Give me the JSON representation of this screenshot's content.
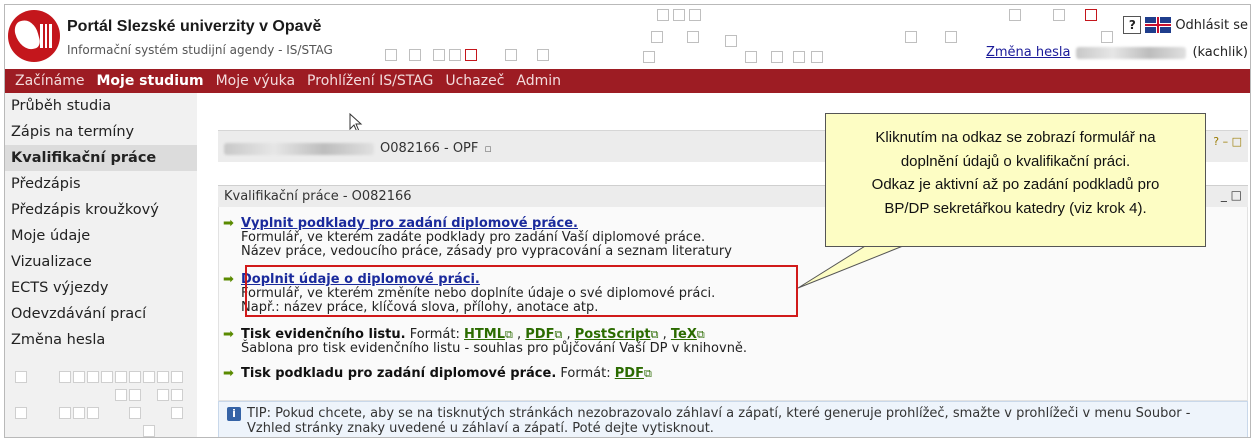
{
  "header": {
    "title": "Portál Slezské univerzity v Opavě",
    "subtitle": "Informační systém studijní agendy - IS/STAG",
    "help": "?",
    "logout": "Odhlásit se",
    "change_password": "Změna hesla",
    "username": "(kachlik)"
  },
  "menu": {
    "items": [
      "Začínáme",
      "Moje studium",
      "Moje výuka",
      "Prohlížení IS/STAG",
      "Uchazeč",
      "Admin"
    ],
    "active": "Moje studium"
  },
  "sidebar": {
    "items": [
      "Průběh studia",
      "Zápis na termíny",
      "Kvalifikační práce",
      "Předzápis",
      "Předzápis kroužkový",
      "Moje údaje",
      "Vizualizace",
      "ECTS výjezdy",
      "Odevzdávání prací",
      "Změna hesla"
    ],
    "active": "Kvalifikační práce"
  },
  "student_bar": {
    "id": "O082166 - OPF",
    "controls": "? – □"
  },
  "panel": {
    "title": "Kvalifikační práce - O082166",
    "controls": "_ □",
    "items": [
      {
        "link": "Vyplnit podklady pro zadání diplomové práce.",
        "desc1": "Formulář, ve kterém zadáte podklady pro zadání Vaší diplomové práce.",
        "desc2": "Název práce, vedoucího práce, zásady pro vypracování a seznam literatury"
      },
      {
        "link": "Doplnit údaje o diplomové práci.",
        "desc1": "Formulář, ve kterém změníte nebo doplníte údaje o své diplomové práci.",
        "desc2": "Např.: název práce, klíčová slova, přílohy, anotace atp."
      },
      {
        "label": "Tisk evidenčního listu.",
        "format_label": "Formát:",
        "formats": [
          "HTML",
          "PDF",
          "PostScript",
          "TeX"
        ],
        "desc1": "Šablona pro tisk evidenčního listu - souhlas pro půjčování Vaší DP v knihovně."
      },
      {
        "label": "Tisk podkladu pro zadání diplomové práce.",
        "format_label": "Formát:",
        "formats": [
          "PDF"
        ]
      }
    ]
  },
  "tip": {
    "text": "TIP: Pokud chcete, aby se na tisknutých stránkách nezobrazovalo záhlaví a zápatí, které generuje prohlížeč, smažte v prohlížeči v menu Soubor - Vzhled stránky znaky uvedené u záhlaví a zápatí. Poté dejte vytisknout."
  },
  "callout": {
    "line1": "Kliknutím na odkaz se zobrazí formulář na",
    "line2": "doplnění údajů o kvalifikační práci.",
    "line3": "Odkaz je aktivní až po zadání podkladů pro",
    "line4": "BP/DP sekretářkou katedry (viz krok 4)."
  },
  "colors": {
    "menu_bg": "#9d1c23",
    "link": "#1a2a9c",
    "format_link": "#2b6b00",
    "highlight": "#d11a1a",
    "callout_bg": "#fdfdc4"
  }
}
